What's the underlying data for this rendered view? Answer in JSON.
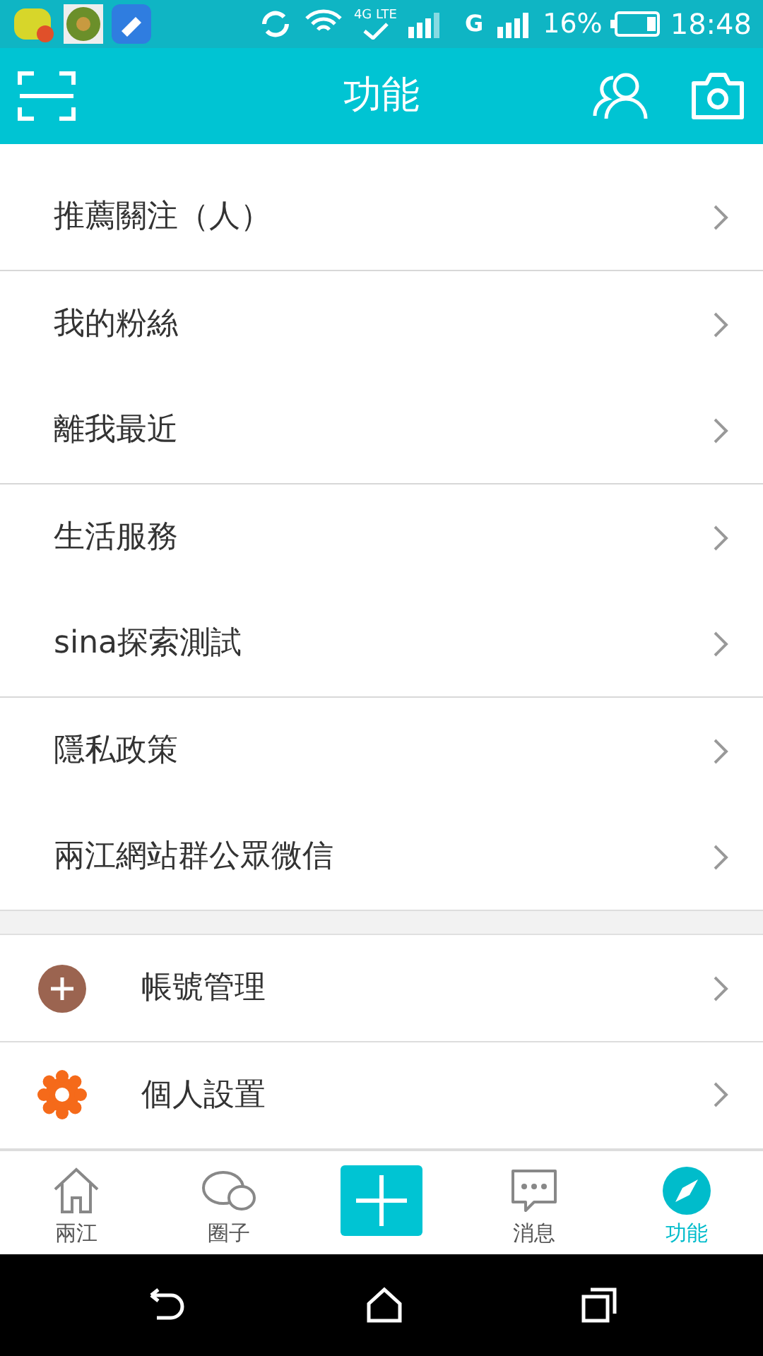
{
  "status_bar": {
    "network": "4G LTE",
    "carrier_2": "G",
    "battery": "16%",
    "time": "18:48"
  },
  "header": {
    "title": "功能"
  },
  "groups": [
    {
      "items": [
        {
          "label": "推薦關注（人）"
        }
      ]
    },
    {
      "items": [
        {
          "label": "我的粉絲"
        },
        {
          "label": "離我最近"
        }
      ]
    },
    {
      "items": [
        {
          "label": "生活服務"
        },
        {
          "label": "sina探索測試"
        }
      ]
    },
    {
      "items": [
        {
          "label": "隱私政策"
        },
        {
          "label": "兩江網站群公眾微信"
        }
      ]
    },
    {
      "items": [
        {
          "label": "帳號管理",
          "kind": "account"
        },
        {
          "label": "個人設置",
          "kind": "settings"
        }
      ]
    }
  ],
  "tab_bar": [
    {
      "label": "兩江",
      "kind": "home",
      "selected": false
    },
    {
      "label": "圈子",
      "kind": "chat",
      "selected": false
    },
    {
      "kind": "add",
      "selected": false
    },
    {
      "label": "消息",
      "kind": "message",
      "selected": false
    },
    {
      "label": "功能",
      "kind": "compass",
      "selected": true
    }
  ]
}
